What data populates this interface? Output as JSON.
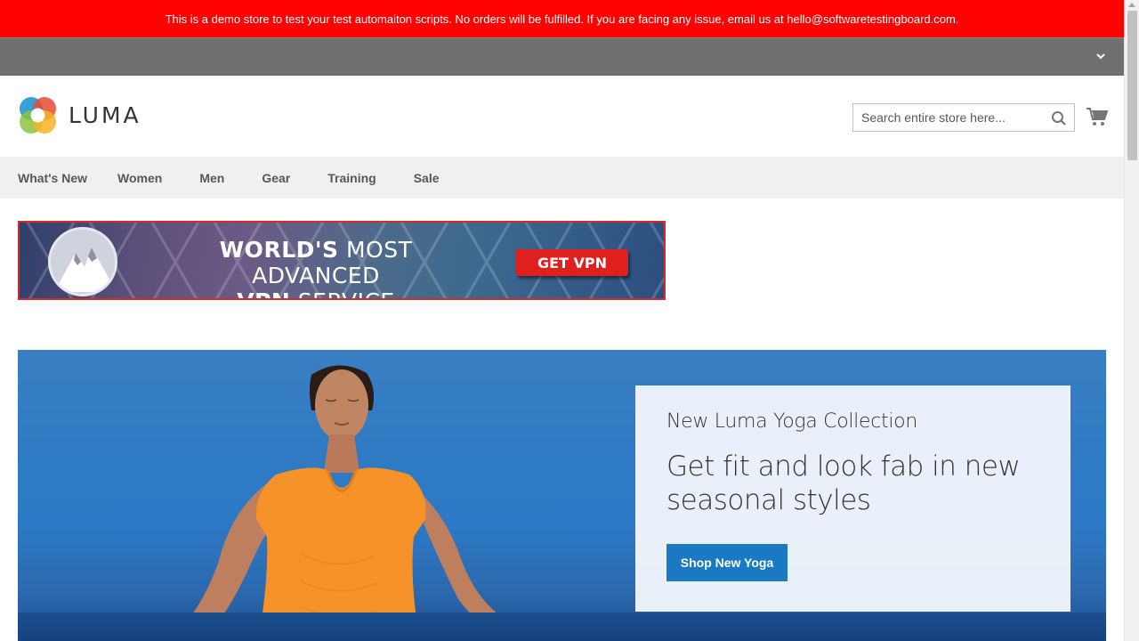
{
  "notice": {
    "text": "This is a demo store to test your test automaiton scripts. No orders will be fulfilled. If you are facing any issue, email us at hello@softwaretestingboard.com."
  },
  "header": {
    "logo_text": "LUMA",
    "search": {
      "placeholder": "Search entire store here..."
    },
    "icons": {
      "search": "search-icon",
      "cart": "cart-icon",
      "panel_toggle": "chevron-down-icon"
    }
  },
  "nav": {
    "items": [
      {
        "label": "What's New"
      },
      {
        "label": "Women"
      },
      {
        "label": "Men"
      },
      {
        "label": "Gear"
      },
      {
        "label": "Training"
      },
      {
        "label": "Sale"
      }
    ]
  },
  "ad": {
    "headline_line1_bold": "WORLD'S",
    "headline_line1_rest": "MOST ADVANCED",
    "headline_line2_bold": "VPN",
    "headline_line2_rest": "SERVICE",
    "cta": "GET VPN"
  },
  "hero": {
    "subtitle": "New Luma Yoga Collection",
    "title": "Get fit and look fab in new seasonal styles",
    "button": "Shop New Yoga"
  },
  "colors": {
    "notice_bg": "#ff0101",
    "panel_bg": "#6e716e",
    "nav_bg": "#f0f0f0",
    "primary_button": "#1979c3",
    "ad_cta": "#e01f1f"
  }
}
